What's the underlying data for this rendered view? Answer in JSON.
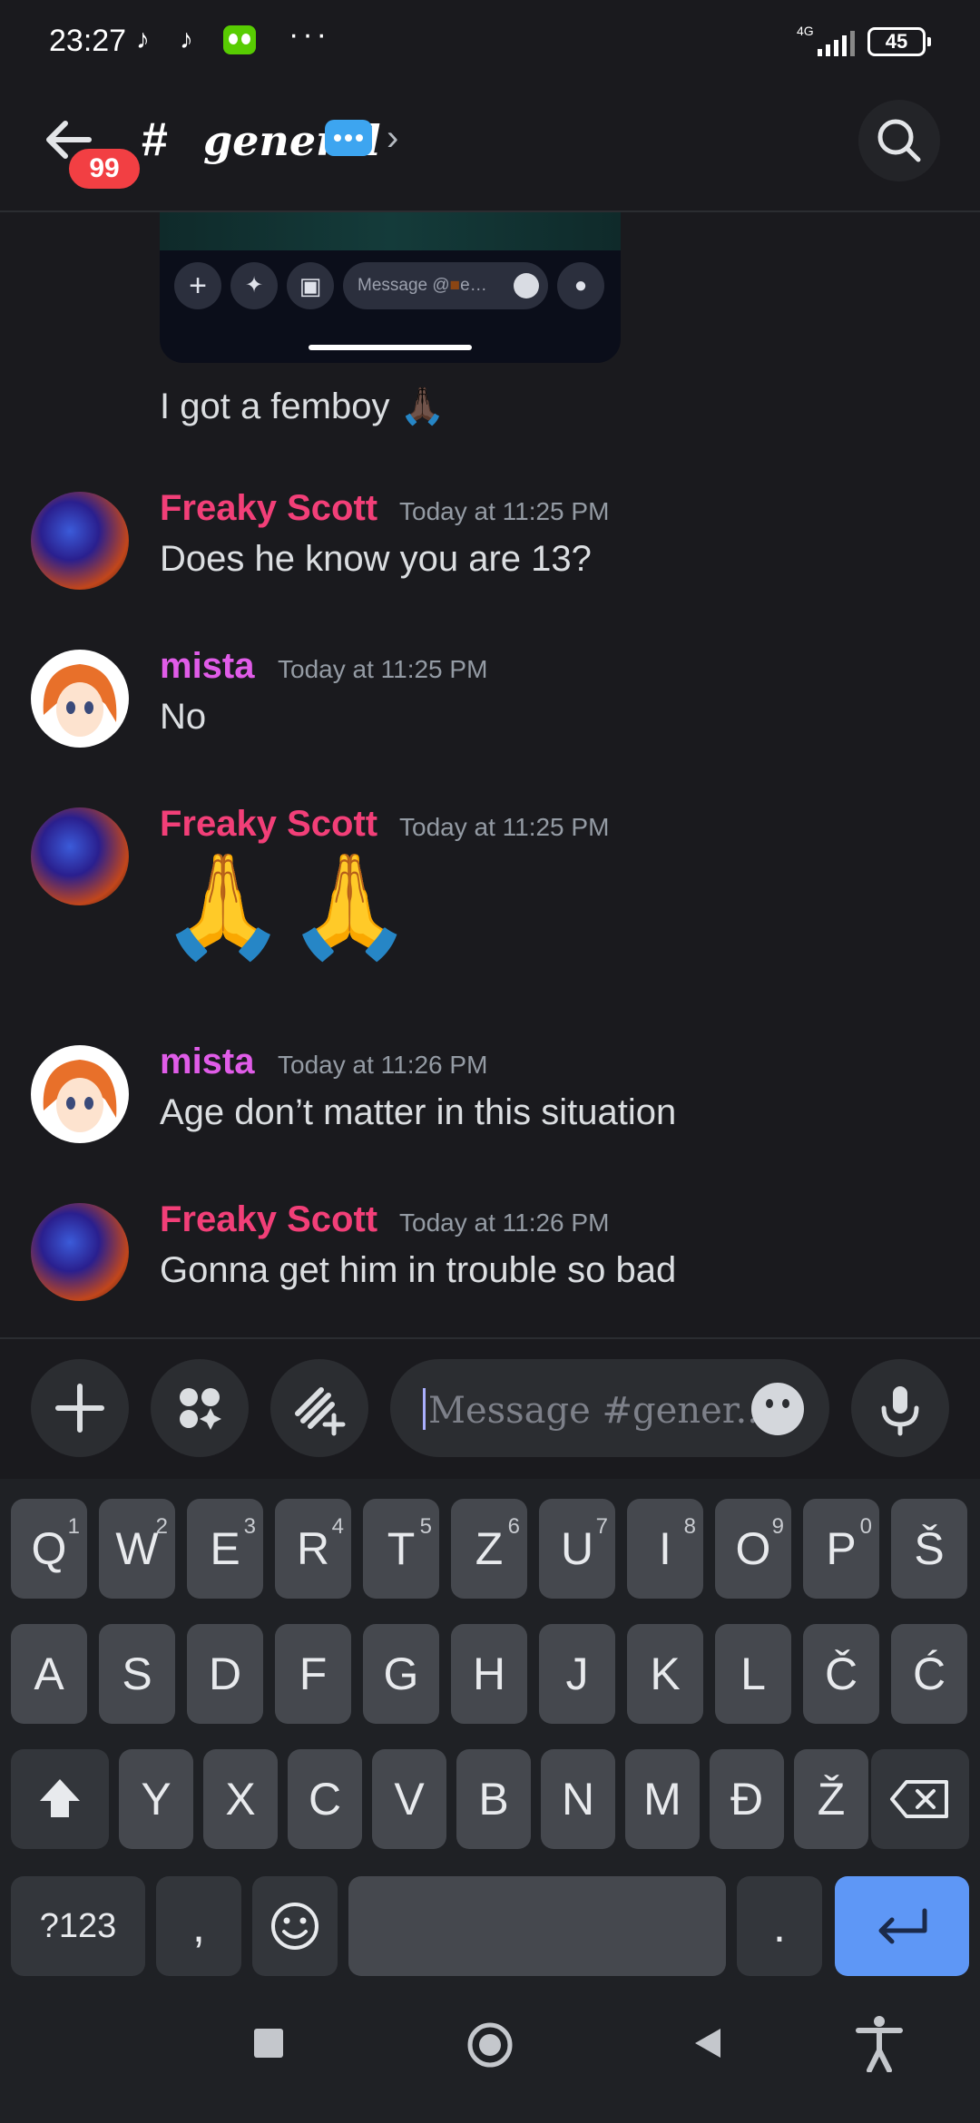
{
  "status_bar": {
    "time": "23:27",
    "network": "4G",
    "battery": "45"
  },
  "header": {
    "unread_badge": "99",
    "channel_name": "general"
  },
  "embed": {
    "message_placeholder": "Message @",
    "placeholder_suffix": "e…"
  },
  "first_message": {
    "text": "I got a femboy",
    "emoji": "🙏🏿"
  },
  "messages": [
    {
      "author": "Freaky Scott",
      "author_color": "#f23f78",
      "time": "Today at 11:25 PM",
      "text": "Does he know you are 13?"
    },
    {
      "author": "mista",
      "author_color": "#e05ce8",
      "time": "Today at 11:25 PM",
      "text": "No"
    },
    {
      "author": "Freaky Scott",
      "author_color": "#f23f78",
      "time": "Today at 11:25 PM",
      "text": "🙏🙏"
    },
    {
      "author": "mista",
      "author_color": "#e05ce8",
      "time": "Today at 11:26 PM",
      "text": "Age don’t matter in this situation"
    },
    {
      "author": "Freaky Scott",
      "author_color": "#f23f78",
      "time": "Today at 11:26 PM",
      "text": "Gonna get him in trouble so bad"
    }
  ],
  "composer": {
    "placeholder": "Message #gener..."
  },
  "keyboard": {
    "row1": [
      "Q",
      "W",
      "E",
      "R",
      "T",
      "Z",
      "U",
      "I",
      "O",
      "P",
      "Š"
    ],
    "row1_hints": [
      "1",
      "2",
      "3",
      "4",
      "5",
      "6",
      "7",
      "8",
      "9",
      "0",
      ""
    ],
    "row2": [
      "A",
      "S",
      "D",
      "F",
      "G",
      "H",
      "J",
      "K",
      "L",
      "Č",
      "Ć"
    ],
    "row3": [
      "Y",
      "X",
      "C",
      "V",
      "B",
      "N",
      "M",
      "Đ",
      "Ž"
    ],
    "symbols_key": "?123",
    "comma_key": ",",
    "period_key": "."
  },
  "colors": {
    "background": "#1a1a1e",
    "accent": "#5e97f6",
    "badge": "#f23f43"
  }
}
